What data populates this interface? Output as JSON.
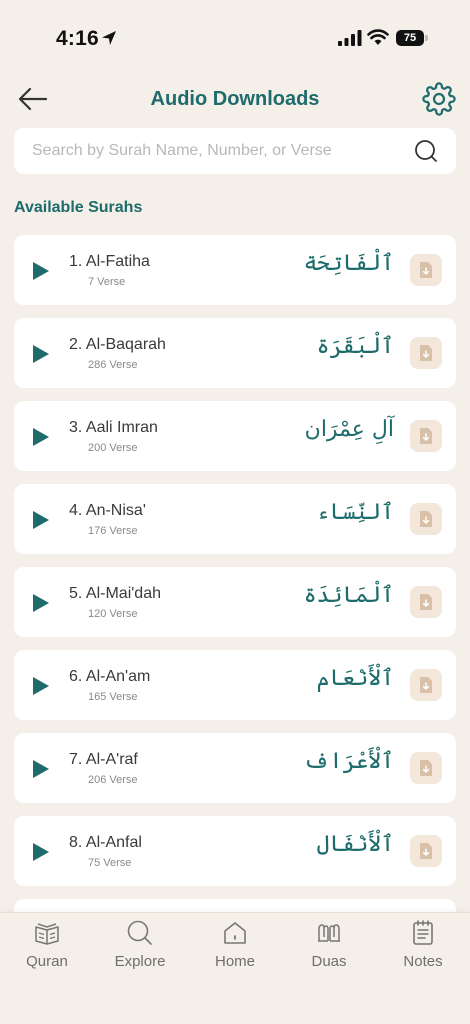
{
  "status": {
    "time": "4:16",
    "battery": "75"
  },
  "header": {
    "title": "Audio Downloads"
  },
  "search": {
    "placeholder": "Search by Surah Name, Number, or Verse"
  },
  "section_title": "Available Surahs",
  "surahs": [
    {
      "name": "1. Al-Fatiha",
      "verses": "7 Verse",
      "arabic": "ٱلْفَاتِحَة"
    },
    {
      "name": "2. Al-Baqarah",
      "verses": "286 Verse",
      "arabic": "ٱلْبَقَرَة"
    },
    {
      "name": "3. Aali Imran",
      "verses": "200 Verse",
      "arabic": "آلِ عِمْرَان"
    },
    {
      "name": "4. An-Nisa'",
      "verses": "176 Verse",
      "arabic": "ٱلنِّسَاء"
    },
    {
      "name": "5. Al-Mai'dah",
      "verses": "120 Verse",
      "arabic": "ٱلْمَائِدَة"
    },
    {
      "name": "6. Al-An'am",
      "verses": "165 Verse",
      "arabic": "ٱلْأَنْعَام"
    },
    {
      "name": "7. Al-A'raf",
      "verses": "206 Verse",
      "arabic": "ٱلْأَعْرَاف"
    },
    {
      "name": "8. Al-Anfal",
      "verses": "75 Verse",
      "arabic": "ٱلْأَنْفَال"
    }
  ],
  "nav": [
    {
      "label": "Quran",
      "icon": "quran-icon"
    },
    {
      "label": "Explore",
      "icon": "search-icon"
    },
    {
      "label": "Home",
      "icon": "home-icon"
    },
    {
      "label": "Duas",
      "icon": "duas-icon"
    },
    {
      "label": "Notes",
      "icon": "notes-icon"
    }
  ],
  "colors": {
    "accent": "#1e6b6c",
    "background": "#f5efe9",
    "card": "#ffffff",
    "download_bg": "#f3e6da"
  }
}
